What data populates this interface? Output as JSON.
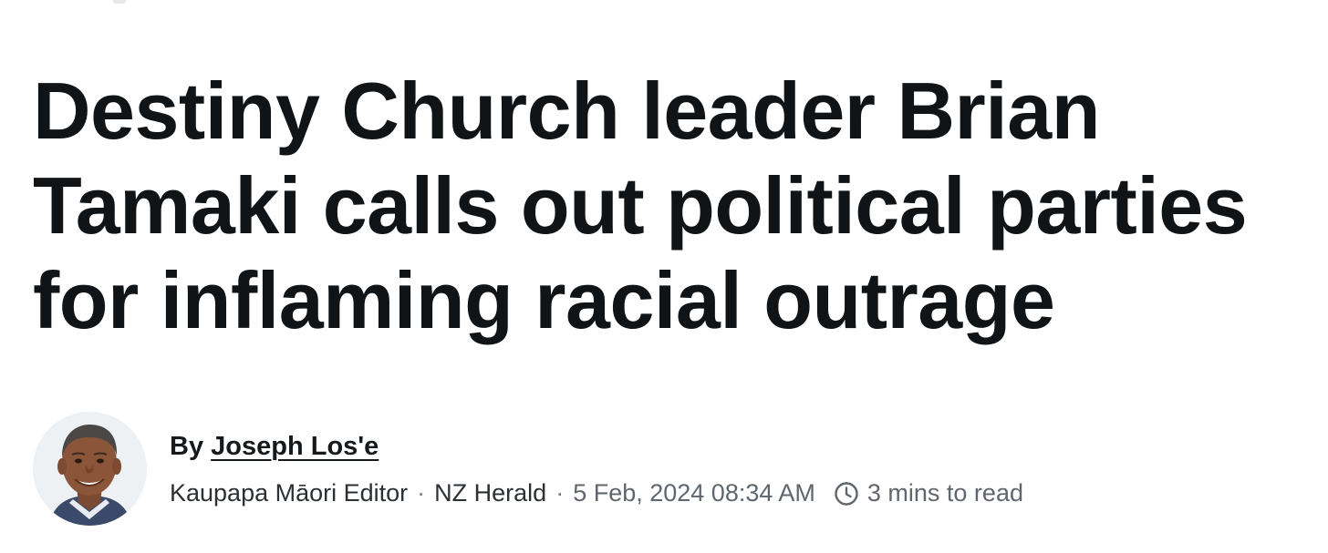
{
  "article": {
    "headline_lines": [
      "Destiny Church leader Brian",
      "Tamaki calls out political parties",
      "for inflaming racial outrage"
    ],
    "byline": {
      "by_prefix": "By",
      "author_name": "Joseph Los'e",
      "author_title": "Kaupapa Māori Editor",
      "separator": "·",
      "publication": "NZ Herald",
      "date": "5 Feb, 2024 08:34 AM",
      "read_time": "3 mins to read",
      "read_time_icon": "clock-icon"
    }
  },
  "colors": {
    "headline": "#101416",
    "meta_secondary": "#5f666d"
  }
}
